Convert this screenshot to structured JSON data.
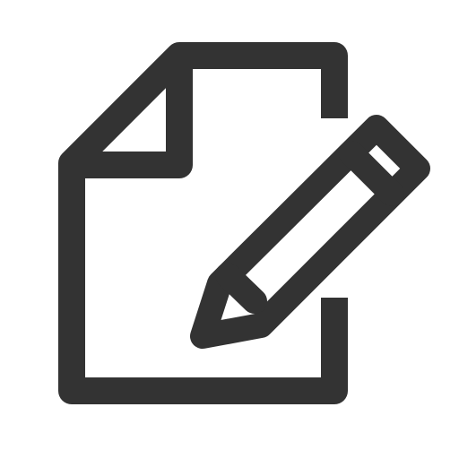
{
  "icon": {
    "name": "edit-document-icon",
    "parts": [
      "document-icon",
      "pencil-icon"
    ],
    "stroke_color": "#333333",
    "background_color": "#ffffff"
  }
}
